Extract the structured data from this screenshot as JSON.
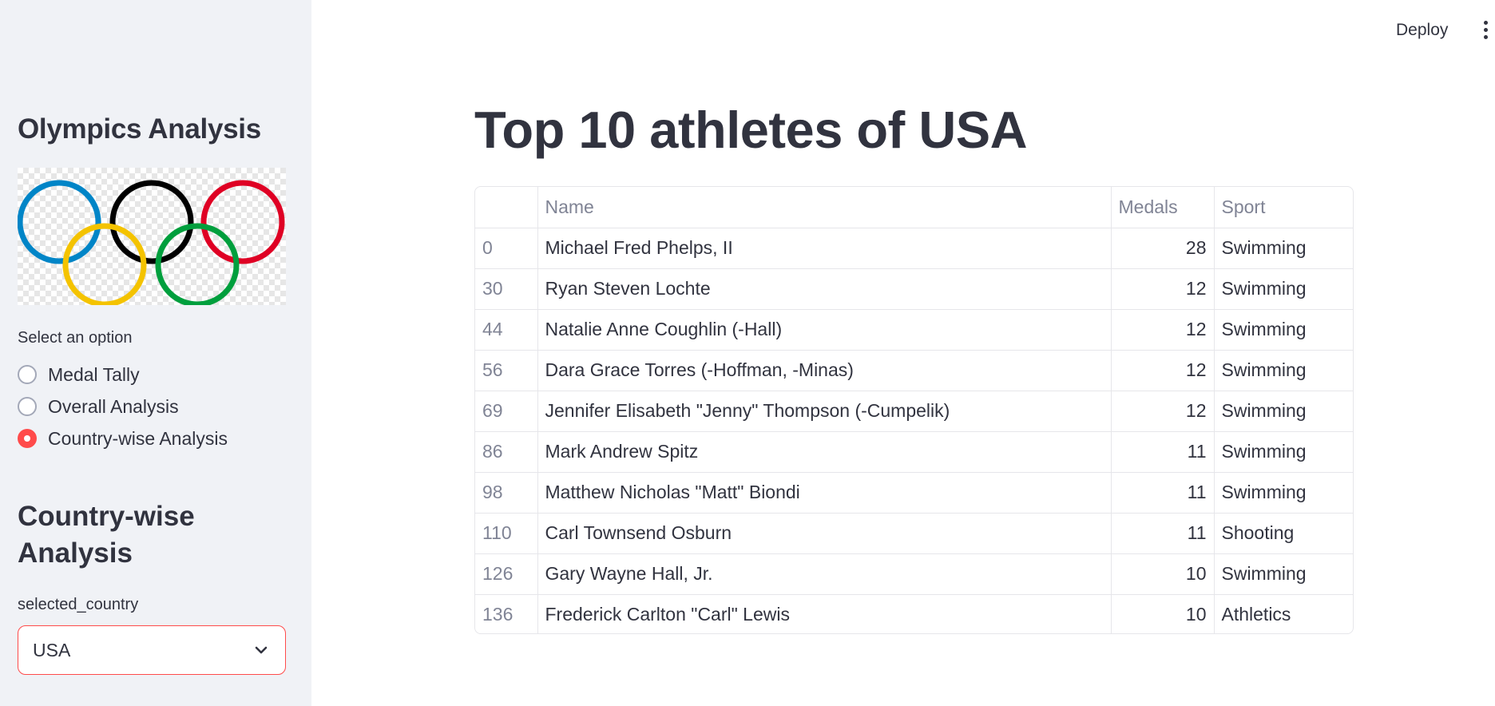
{
  "sidebar": {
    "title": "Olympics Analysis",
    "radio_label": "Select an option",
    "options": [
      "Medal Tally",
      "Overall Analysis",
      "Country-wise Analysis"
    ],
    "selected_option": "Country-wise Analysis",
    "subtitle": "Country-wise Analysis",
    "select_label": "selected_country",
    "select_value": "USA"
  },
  "topbar": {
    "deploy_label": "Deploy",
    "menu_icon": "kebab-menu-icon"
  },
  "main": {
    "title": "Top 10 athletes of USA",
    "table": {
      "columns": [
        "",
        "Name",
        "Medals",
        "Sport"
      ],
      "rows": [
        {
          "index": "0",
          "name": "Michael Fred Phelps, II",
          "medals": "28",
          "sport": "Swimming"
        },
        {
          "index": "30",
          "name": "Ryan Steven Lochte",
          "medals": "12",
          "sport": "Swimming"
        },
        {
          "index": "44",
          "name": "Natalie Anne Coughlin (-Hall)",
          "medals": "12",
          "sport": "Swimming"
        },
        {
          "index": "56",
          "name": "Dara Grace Torres (-Hoffman, -Minas)",
          "medals": "12",
          "sport": "Swimming"
        },
        {
          "index": "69",
          "name": "Jennifer Elisabeth \"Jenny\" Thompson (-Cumpelik)",
          "medals": "12",
          "sport": "Swimming"
        },
        {
          "index": "86",
          "name": "Mark Andrew Spitz",
          "medals": "11",
          "sport": "Swimming"
        },
        {
          "index": "98",
          "name": "Matthew Nicholas \"Matt\" Biondi",
          "medals": "11",
          "sport": "Swimming"
        },
        {
          "index": "110",
          "name": "Carl Townsend Osburn",
          "medals": "11",
          "sport": "Shooting"
        },
        {
          "index": "126",
          "name": "Gary Wayne Hall, Jr.",
          "medals": "10",
          "sport": "Swimming"
        },
        {
          "index": "136",
          "name": "Frederick Carlton \"Carl\" Lewis",
          "medals": "10",
          "sport": "Athletics"
        }
      ]
    }
  },
  "colors": {
    "accent": "#ff4b4b",
    "sidebar_bg": "#f0f2f6",
    "text": "#31333f",
    "ring_blue": "#0085c7",
    "ring_black": "#000000",
    "ring_red": "#df0024",
    "ring_yellow": "#f4c300",
    "ring_green": "#009f3d"
  }
}
